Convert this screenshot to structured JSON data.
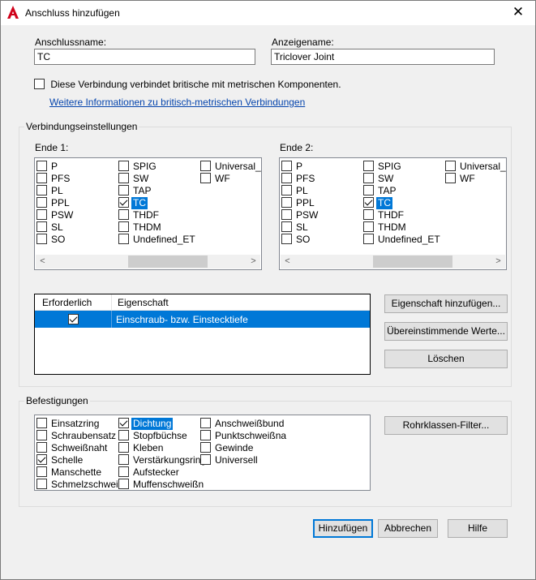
{
  "window": {
    "title": "Anschluss hinzufügen",
    "close_glyph": "✕",
    "app_icon": "autocad-icon",
    "accent_color": "#0078d7"
  },
  "connection_name": {
    "label": "Anschlussname:",
    "value": "TC"
  },
  "display_name": {
    "label": "Anzeigename:",
    "value": "Triclover Joint"
  },
  "imperial_metric": {
    "label": "Diese Verbindung verbindet britische mit metrischen Komponenten.",
    "checked": false
  },
  "info_link": "Weitere Informationen zu britisch-metrischen Verbindungen",
  "connection_settings": {
    "title": "Verbindungseinstellungen",
    "end1": {
      "label": "Ende 1:",
      "col1": [
        "P",
        "PFS",
        "PL",
        "PPL",
        "PSW",
        "SL",
        "SO"
      ],
      "col2": [
        "SPIG",
        "SW",
        "TAP",
        "TC",
        "THDF",
        "THDM",
        "Undefined_ET"
      ],
      "col3": [
        "Universal_E",
        "WF"
      ],
      "selected": "TC"
    },
    "end2": {
      "label": "Ende 2:",
      "col1": [
        "P",
        "PFS",
        "PL",
        "PPL",
        "PSW",
        "SL",
        "SO"
      ],
      "col2": [
        "SPIG",
        "SW",
        "TAP",
        "TC",
        "THDF",
        "THDM",
        "Undefined_ET"
      ],
      "col3": [
        "Universal_E",
        "WF"
      ],
      "selected": "TC"
    },
    "scroll_left": "<",
    "scroll_right": ">"
  },
  "property_grid": {
    "col_required": "Erforderlich",
    "col_property": "Eigenschaft",
    "rows": [
      {
        "required": true,
        "property": "Einschraub- bzw. Einstecktiefe"
      }
    ]
  },
  "buttons": {
    "add_property": "Eigenschaft hinzufügen...",
    "matching_values": "Übereinstimmende Werte...",
    "delete": "Löschen",
    "pipe_class_filter": "Rohrklassen-Filter...",
    "add": "Hinzufügen",
    "cancel": "Abbrechen",
    "help": "Hilfe"
  },
  "fasteners": {
    "title": "Befestigungen",
    "col1": [
      {
        "label": "Einsatzring",
        "checked": false
      },
      {
        "label": "Schraubensatz",
        "checked": false
      },
      {
        "label": "Schweißnaht",
        "checked": false
      },
      {
        "label": "Schelle",
        "checked": true
      },
      {
        "label": "Manschette",
        "checked": false
      },
      {
        "label": "Schmelzschweiß",
        "checked": false
      }
    ],
    "col2": [
      {
        "label": "Dichtung",
        "checked": true
      },
      {
        "label": "Stopfbüchse",
        "checked": false
      },
      {
        "label": "Kleben",
        "checked": false
      },
      {
        "label": "Verstärkungsring",
        "checked": false
      },
      {
        "label": "Aufstecker",
        "checked": false
      },
      {
        "label": "Muffenschweißn",
        "checked": false
      }
    ],
    "col3": [
      {
        "label": "Anschweißbund",
        "checked": false
      },
      {
        "label": "Punktschweißna",
        "checked": false
      },
      {
        "label": "Gewinde",
        "checked": false
      },
      {
        "label": "Universell",
        "checked": false
      }
    ],
    "selected": "Dichtung"
  }
}
